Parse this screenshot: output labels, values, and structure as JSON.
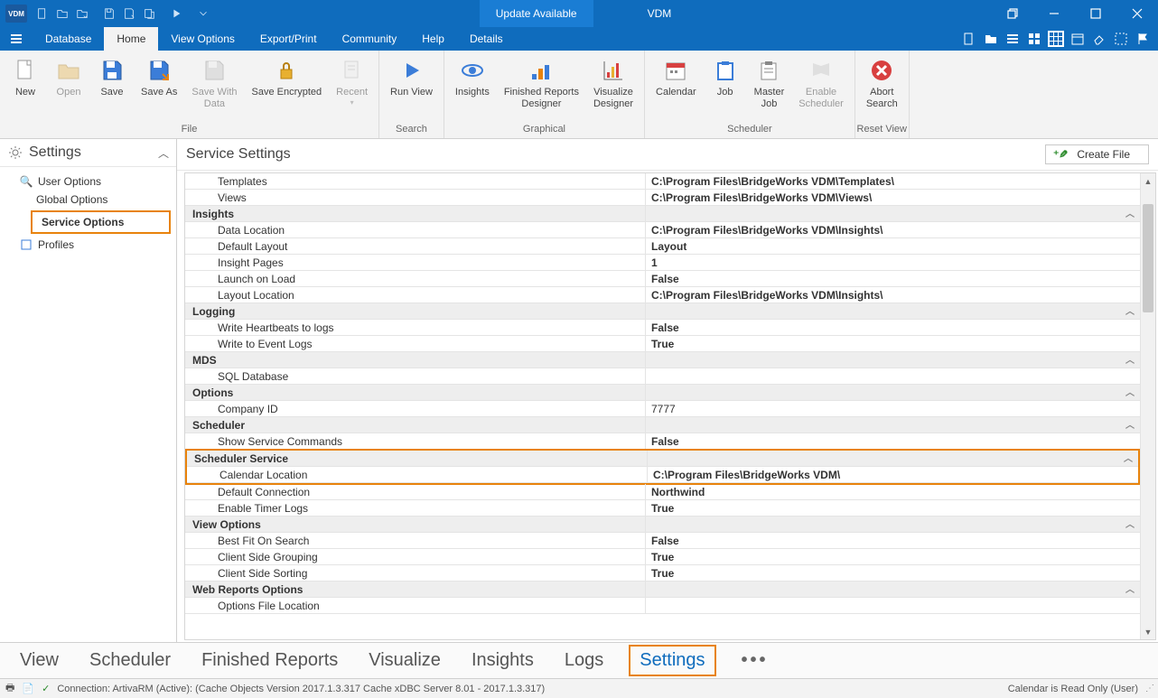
{
  "title_bar": {
    "update_label": "Update Available",
    "app_title": "VDM"
  },
  "menus": {
    "database": "Database",
    "home": "Home",
    "view_options": "View Options",
    "export_print": "Export/Print",
    "community": "Community",
    "help": "Help",
    "details": "Details"
  },
  "ribbon": {
    "groups": {
      "file": "File",
      "search": "Search",
      "graphical": "Graphical",
      "scheduler": "Scheduler",
      "reset_view": "Reset View"
    },
    "btns": {
      "new": "New",
      "open": "Open",
      "save": "Save",
      "save_as": "Save As",
      "save_with_data": "Save With\nData",
      "save_encrypted": "Save Encrypted",
      "recent": "Recent",
      "run_view": "Run View",
      "insights": "Insights",
      "finished_reports": "Finished Reports\nDesigner",
      "visualize": "Visualize\nDesigner",
      "calendar": "Calendar",
      "job": "Job",
      "master_job": "Master\nJob",
      "enable_scheduler": "Enable\nScheduler",
      "abort_search": "Abort\nSearch"
    }
  },
  "side": {
    "title": "Settings",
    "items": {
      "user_options": "User Options",
      "global_options": "Global Options",
      "service_options": "Service Options",
      "profiles": "Profiles"
    }
  },
  "main": {
    "title": "Service Settings",
    "create_file": "Create File"
  },
  "grid": {
    "templates": {
      "k": "Templates",
      "v": "C:\\Program Files\\BridgeWorks VDM\\Templates\\"
    },
    "views": {
      "k": "Views",
      "v": "C:\\Program Files\\BridgeWorks VDM\\Views\\"
    },
    "sec_insights": "Insights",
    "data_location": {
      "k": "Data Location",
      "v": "C:\\Program Files\\BridgeWorks VDM\\Insights\\"
    },
    "default_layout": {
      "k": "Default Layout",
      "v": "Layout"
    },
    "insight_pages": {
      "k": "Insight Pages",
      "v": "1"
    },
    "launch_on_load": {
      "k": "Launch on Load",
      "v": "False"
    },
    "layout_location": {
      "k": "Layout Location",
      "v": "C:\\Program Files\\BridgeWorks VDM\\Insights\\"
    },
    "sec_logging": "Logging",
    "write_heartbeats": {
      "k": "Write Heartbeats to logs",
      "v": "False"
    },
    "write_event_logs": {
      "k": "Write to Event Logs",
      "v": "True"
    },
    "sec_mds": "MDS",
    "sql_database": {
      "k": "SQL Database",
      "v": ""
    },
    "sec_options": "Options",
    "company_id": {
      "k": "Company ID",
      "v": "7777"
    },
    "sec_scheduler": "Scheduler",
    "show_service_commands": {
      "k": "Show Service Commands",
      "v": "False"
    },
    "sec_scheduler_service": "Scheduler Service",
    "calendar_location": {
      "k": "Calendar Location",
      "v": "C:\\Program Files\\BridgeWorks VDM\\"
    },
    "default_connection": {
      "k": "Default Connection",
      "v": "Northwind"
    },
    "enable_timer_logs": {
      "k": "Enable Timer Logs",
      "v": "True"
    },
    "sec_view_options": "View Options",
    "best_fit": {
      "k": "Best Fit On Search",
      "v": "False"
    },
    "client_grouping": {
      "k": "Client Side Grouping",
      "v": "True"
    },
    "client_sorting": {
      "k": "Client Side Sorting",
      "v": "True"
    },
    "sec_web_reports": "Web Reports Options",
    "options_file": {
      "k": "Options File Location",
      "v": ""
    }
  },
  "tabs": {
    "view": "View",
    "scheduler": "Scheduler",
    "finished_reports": "Finished Reports",
    "visualize": "Visualize",
    "insights": "Insights",
    "logs": "Logs",
    "settings": "Settings"
  },
  "status": {
    "connection": "Connection: ArtivaRM (Active): (Cache Objects Version 2017.1.3.317 Cache xDBC Server 8.01 - 2017.1.3.317)",
    "readonly": "Calendar is Read Only (User)"
  }
}
